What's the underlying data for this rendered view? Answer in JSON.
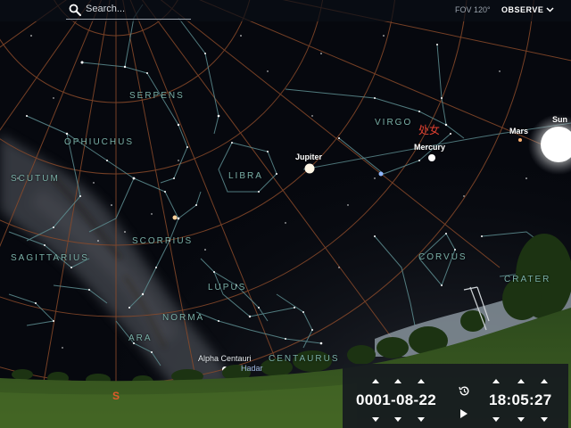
{
  "topbar": {
    "search_placeholder": "Search...",
    "fov": "FOV 120°",
    "observe_label": "OBSERVE"
  },
  "constellations": {
    "serpens": "SERPENS",
    "ophiuchus": "OPHIUCHUS",
    "scutum": "SCUTUM",
    "libra": "LIBRA",
    "virgo": "VIRGO",
    "virgo_cn": "处女",
    "scorpius": "SCORPIUS",
    "sagittarius": "SAGITTARIUS",
    "corvus": "CORVUS",
    "crater": "CRATER",
    "lupus": "LUPUS",
    "norma": "NORMA",
    "ara": "ARA",
    "centaurus": "CENTAURUS"
  },
  "objects": {
    "jupiter": "Jupiter",
    "mercury": "Mercury",
    "mars": "Mars",
    "sun": "Sun",
    "alpha_centauri": "Alpha Centauri",
    "hadar": "Hadar"
  },
  "compass": {
    "south": "S"
  },
  "time_panel": {
    "date": "0001-08-22",
    "time": "18:05:27"
  },
  "colors": {
    "grid": "#8a4a2a",
    "constellation_line": "#5e8f92",
    "constellation_label": "#7ab0a8",
    "compass": "#e05a2a",
    "panel_bg": "#16191f"
  },
  "icons": {
    "search": "search-icon",
    "observe_chevron": "chevron-down-icon",
    "clock": "clock-icon",
    "play": "play-icon"
  }
}
